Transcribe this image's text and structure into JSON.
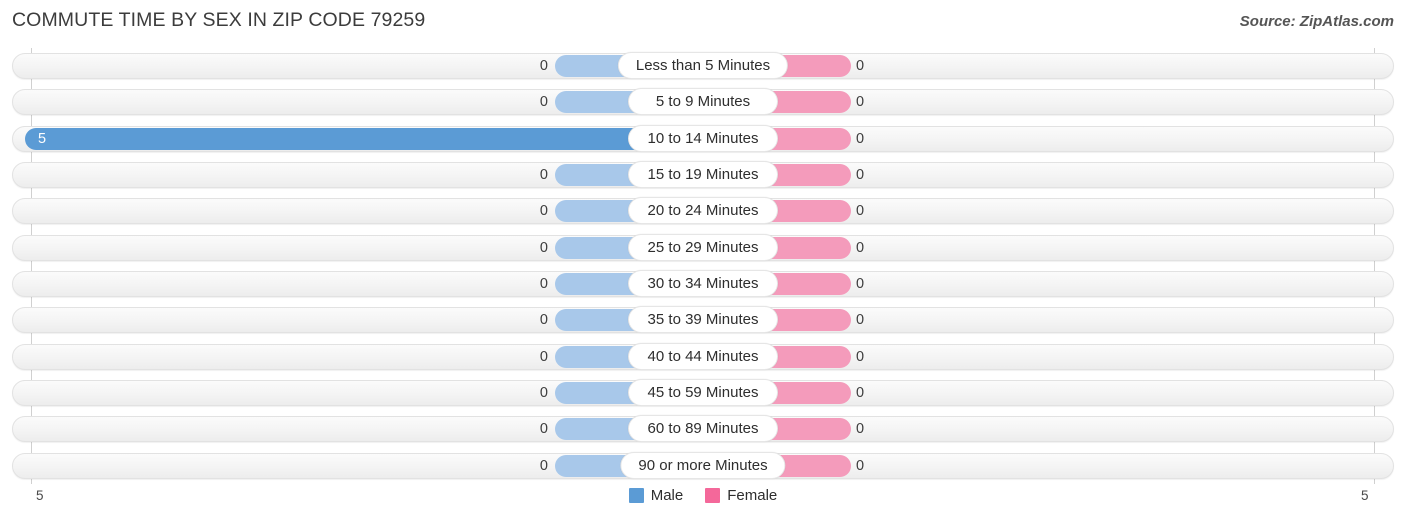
{
  "header": {
    "title": "COMMUTE TIME BY SEX IN ZIP CODE 79259",
    "source": "Source: ZipAtlas.com"
  },
  "legend": {
    "male_label": "Male",
    "female_label": "Female",
    "male_color": "#5b9bd5",
    "female_color": "#f4689a"
  },
  "axis": {
    "left_tick": "5",
    "right_tick": "5"
  },
  "chart_data": {
    "type": "bar",
    "title": "COMMUTE TIME BY SEX IN ZIP CODE 79259",
    "subtitle": "",
    "orientation": "horizontal-diverging",
    "xlabel": "",
    "ylabel": "",
    "xlim": [
      5,
      5
    ],
    "grid": true,
    "legend_position": "bottom-center",
    "categories": [
      "Less than 5 Minutes",
      "5 to 9 Minutes",
      "10 to 14 Minutes",
      "15 to 19 Minutes",
      "20 to 24 Minutes",
      "25 to 29 Minutes",
      "30 to 34 Minutes",
      "35 to 39 Minutes",
      "40 to 44 Minutes",
      "45 to 59 Minutes",
      "60 to 89 Minutes",
      "90 or more Minutes"
    ],
    "series": [
      {
        "name": "Male",
        "values": [
          0,
          0,
          5,
          0,
          0,
          0,
          0,
          0,
          0,
          0,
          0,
          0
        ]
      },
      {
        "name": "Female",
        "values": [
          0,
          0,
          0,
          0,
          0,
          0,
          0,
          0,
          0,
          0,
          0,
          0
        ]
      }
    ],
    "rows": [
      {
        "category": "Less than 5 Minutes",
        "male": "0",
        "female": "0",
        "male_value": 0,
        "female_value": 0,
        "highlight": false
      },
      {
        "category": "5 to 9 Minutes",
        "male": "0",
        "female": "0",
        "male_value": 0,
        "female_value": 0,
        "highlight": false
      },
      {
        "category": "10 to 14 Minutes",
        "male": "5",
        "female": "0",
        "male_value": 5,
        "female_value": 0,
        "highlight": true
      },
      {
        "category": "15 to 19 Minutes",
        "male": "0",
        "female": "0",
        "male_value": 0,
        "female_value": 0,
        "highlight": false
      },
      {
        "category": "20 to 24 Minutes",
        "male": "0",
        "female": "0",
        "male_value": 0,
        "female_value": 0,
        "highlight": false
      },
      {
        "category": "25 to 29 Minutes",
        "male": "0",
        "female": "0",
        "male_value": 0,
        "female_value": 0,
        "highlight": false
      },
      {
        "category": "30 to 34 Minutes",
        "male": "0",
        "female": "0",
        "male_value": 0,
        "female_value": 0,
        "highlight": false
      },
      {
        "category": "35 to 39 Minutes",
        "male": "0",
        "female": "0",
        "male_value": 0,
        "female_value": 0,
        "highlight": false
      },
      {
        "category": "40 to 44 Minutes",
        "male": "0",
        "female": "0",
        "male_value": 0,
        "female_value": 0,
        "highlight": false
      },
      {
        "category": "45 to 59 Minutes",
        "male": "0",
        "female": "0",
        "male_value": 0,
        "female_value": 0,
        "highlight": false
      },
      {
        "category": "60 to 89 Minutes",
        "male": "0",
        "female": "0",
        "male_value": 0,
        "female_value": 0,
        "highlight": false
      },
      {
        "category": "90 or more Minutes",
        "male": "0",
        "female": "0",
        "male_value": 0,
        "female_value": 0,
        "highlight": false
      }
    ]
  }
}
